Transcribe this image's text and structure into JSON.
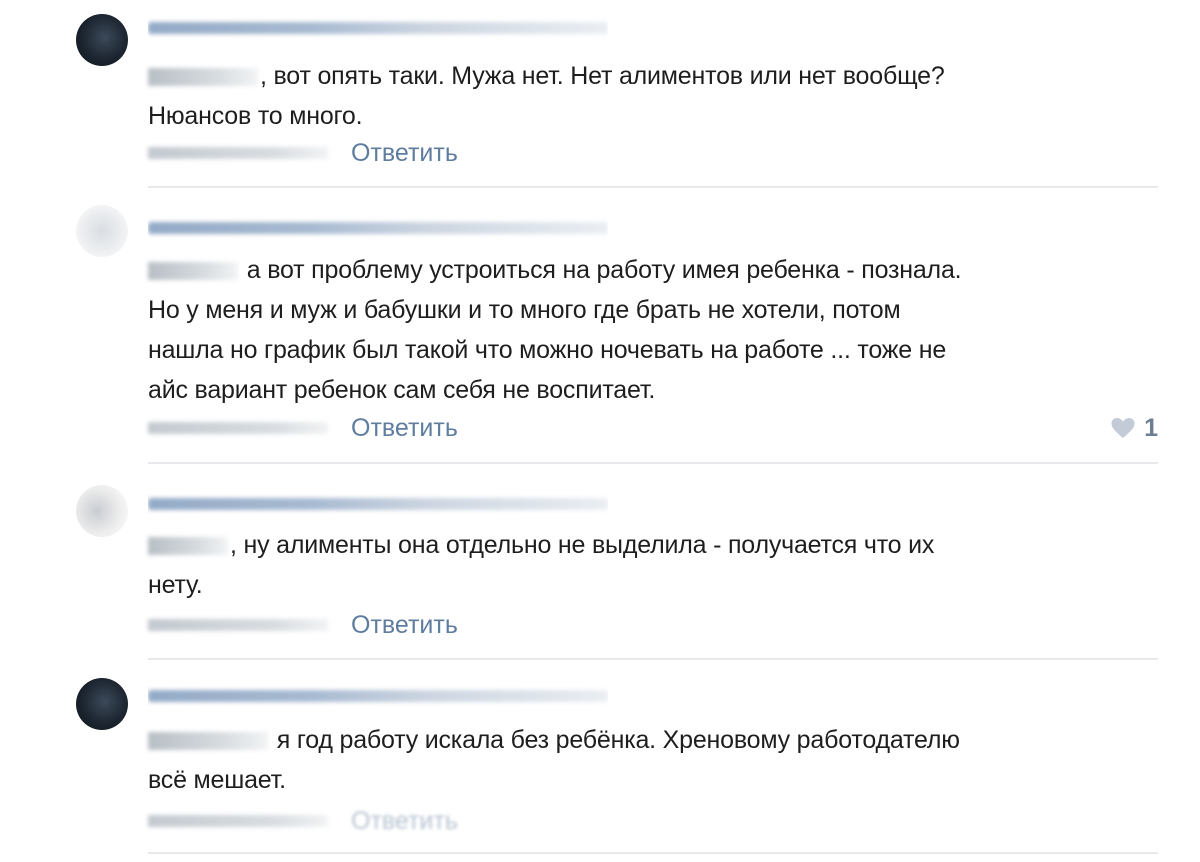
{
  "comments": [
    {
      "text": ", вот опять таки. Мужа нет. Нет алиментов или нет вообще?\nНюансов то много.",
      "reply_label": "Ответить"
    },
    {
      "text": " а вот проблему устроиться на работу имея ребенка - познала.\nНо у меня и муж и бабушки и то много где брать не хотели, потом\nнашла но график был такой что можно ночевать на работе ... тоже не\nайс вариант ребенок сам себя не воспитает.",
      "reply_label": "Ответить",
      "likes": "1"
    },
    {
      "text": ", ну алименты она отдельно не выделила - получается что их\nнету.",
      "reply_label": "Ответить"
    },
    {
      "text": " я год работу искала без ребёнка. Хреновому работодателю\nвсё мешает.",
      "reply_label": "Ответить"
    }
  ],
  "colors": {
    "link": "#5f7d9f",
    "text": "#1e1e1e",
    "divider": "#e6e8eb",
    "like": "#c3ccd6"
  },
  "icons": {
    "like": "heart-icon"
  }
}
